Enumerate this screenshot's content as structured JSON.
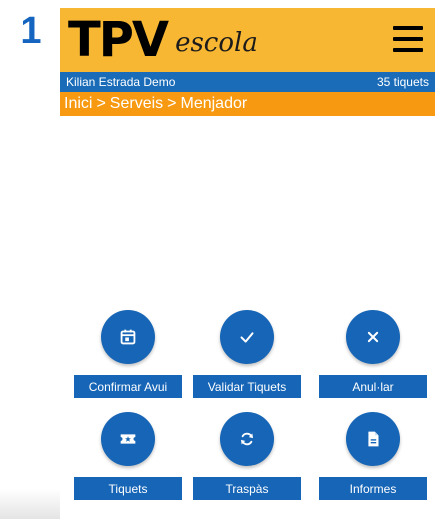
{
  "step": "1",
  "header": {
    "logo_main": "TPV",
    "logo_script": "escola"
  },
  "userbar": {
    "user": "Kilian Estrada Demo",
    "tickets": "35 tiquets"
  },
  "breadcrumb": {
    "items": [
      "Inici",
      "Serveis",
      "Menjador"
    ],
    "separator": ">"
  },
  "actions": [
    {
      "label": "Confirmar Avui",
      "icon": "calendar-icon"
    },
    {
      "label": "Validar Tiquets",
      "icon": "check-icon"
    },
    {
      "label": "Anul·lar",
      "icon": "close-icon"
    },
    {
      "label": "Tiquets",
      "icon": "ticket-icon"
    },
    {
      "label": "Traspàs",
      "icon": "sync-icon"
    },
    {
      "label": "Informes",
      "icon": "document-icon"
    }
  ],
  "colors": {
    "header": "#f7b733",
    "userbar": "#1a6cb8",
    "breadcrumb": "#f79a12",
    "button": "#1665b6"
  }
}
